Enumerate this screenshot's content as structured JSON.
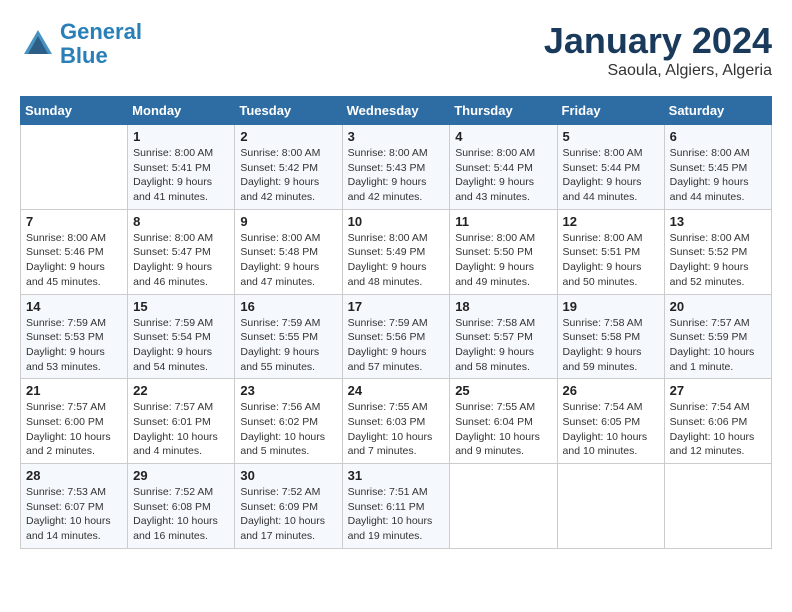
{
  "header": {
    "logo_line1": "General",
    "logo_line2": "Blue",
    "month_title": "January 2024",
    "location": "Saoula, Algiers, Algeria"
  },
  "days_of_week": [
    "Sunday",
    "Monday",
    "Tuesday",
    "Wednesday",
    "Thursday",
    "Friday",
    "Saturday"
  ],
  "weeks": [
    [
      {
        "day": "",
        "info": ""
      },
      {
        "day": "1",
        "info": "Sunrise: 8:00 AM\nSunset: 5:41 PM\nDaylight: 9 hours\nand 41 minutes."
      },
      {
        "day": "2",
        "info": "Sunrise: 8:00 AM\nSunset: 5:42 PM\nDaylight: 9 hours\nand 42 minutes."
      },
      {
        "day": "3",
        "info": "Sunrise: 8:00 AM\nSunset: 5:43 PM\nDaylight: 9 hours\nand 42 minutes."
      },
      {
        "day": "4",
        "info": "Sunrise: 8:00 AM\nSunset: 5:44 PM\nDaylight: 9 hours\nand 43 minutes."
      },
      {
        "day": "5",
        "info": "Sunrise: 8:00 AM\nSunset: 5:44 PM\nDaylight: 9 hours\nand 44 minutes."
      },
      {
        "day": "6",
        "info": "Sunrise: 8:00 AM\nSunset: 5:45 PM\nDaylight: 9 hours\nand 44 minutes."
      }
    ],
    [
      {
        "day": "7",
        "info": "Sunrise: 8:00 AM\nSunset: 5:46 PM\nDaylight: 9 hours\nand 45 minutes."
      },
      {
        "day": "8",
        "info": "Sunrise: 8:00 AM\nSunset: 5:47 PM\nDaylight: 9 hours\nand 46 minutes."
      },
      {
        "day": "9",
        "info": "Sunrise: 8:00 AM\nSunset: 5:48 PM\nDaylight: 9 hours\nand 47 minutes."
      },
      {
        "day": "10",
        "info": "Sunrise: 8:00 AM\nSunset: 5:49 PM\nDaylight: 9 hours\nand 48 minutes."
      },
      {
        "day": "11",
        "info": "Sunrise: 8:00 AM\nSunset: 5:50 PM\nDaylight: 9 hours\nand 49 minutes."
      },
      {
        "day": "12",
        "info": "Sunrise: 8:00 AM\nSunset: 5:51 PM\nDaylight: 9 hours\nand 50 minutes."
      },
      {
        "day": "13",
        "info": "Sunrise: 8:00 AM\nSunset: 5:52 PM\nDaylight: 9 hours\nand 52 minutes."
      }
    ],
    [
      {
        "day": "14",
        "info": "Sunrise: 7:59 AM\nSunset: 5:53 PM\nDaylight: 9 hours\nand 53 minutes."
      },
      {
        "day": "15",
        "info": "Sunrise: 7:59 AM\nSunset: 5:54 PM\nDaylight: 9 hours\nand 54 minutes."
      },
      {
        "day": "16",
        "info": "Sunrise: 7:59 AM\nSunset: 5:55 PM\nDaylight: 9 hours\nand 55 minutes."
      },
      {
        "day": "17",
        "info": "Sunrise: 7:59 AM\nSunset: 5:56 PM\nDaylight: 9 hours\nand 57 minutes."
      },
      {
        "day": "18",
        "info": "Sunrise: 7:58 AM\nSunset: 5:57 PM\nDaylight: 9 hours\nand 58 minutes."
      },
      {
        "day": "19",
        "info": "Sunrise: 7:58 AM\nSunset: 5:58 PM\nDaylight: 9 hours\nand 59 minutes."
      },
      {
        "day": "20",
        "info": "Sunrise: 7:57 AM\nSunset: 5:59 PM\nDaylight: 10 hours\nand 1 minute."
      }
    ],
    [
      {
        "day": "21",
        "info": "Sunrise: 7:57 AM\nSunset: 6:00 PM\nDaylight: 10 hours\nand 2 minutes."
      },
      {
        "day": "22",
        "info": "Sunrise: 7:57 AM\nSunset: 6:01 PM\nDaylight: 10 hours\nand 4 minutes."
      },
      {
        "day": "23",
        "info": "Sunrise: 7:56 AM\nSunset: 6:02 PM\nDaylight: 10 hours\nand 5 minutes."
      },
      {
        "day": "24",
        "info": "Sunrise: 7:55 AM\nSunset: 6:03 PM\nDaylight: 10 hours\nand 7 minutes."
      },
      {
        "day": "25",
        "info": "Sunrise: 7:55 AM\nSunset: 6:04 PM\nDaylight: 10 hours\nand 9 minutes."
      },
      {
        "day": "26",
        "info": "Sunrise: 7:54 AM\nSunset: 6:05 PM\nDaylight: 10 hours\nand 10 minutes."
      },
      {
        "day": "27",
        "info": "Sunrise: 7:54 AM\nSunset: 6:06 PM\nDaylight: 10 hours\nand 12 minutes."
      }
    ],
    [
      {
        "day": "28",
        "info": "Sunrise: 7:53 AM\nSunset: 6:07 PM\nDaylight: 10 hours\nand 14 minutes."
      },
      {
        "day": "29",
        "info": "Sunrise: 7:52 AM\nSunset: 6:08 PM\nDaylight: 10 hours\nand 16 minutes."
      },
      {
        "day": "30",
        "info": "Sunrise: 7:52 AM\nSunset: 6:09 PM\nDaylight: 10 hours\nand 17 minutes."
      },
      {
        "day": "31",
        "info": "Sunrise: 7:51 AM\nSunset: 6:11 PM\nDaylight: 10 hours\nand 19 minutes."
      },
      {
        "day": "",
        "info": ""
      },
      {
        "day": "",
        "info": ""
      },
      {
        "day": "",
        "info": ""
      }
    ]
  ]
}
